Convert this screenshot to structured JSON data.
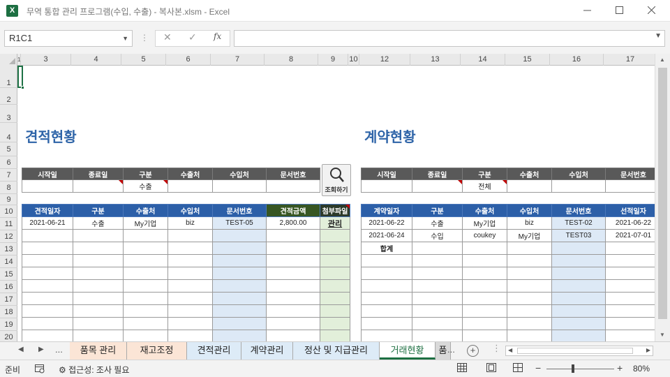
{
  "window": {
    "title": "무역 통합 관리 프로그램(수입, 수출) - 복사본.xlsm - Excel",
    "app_icon": "excel-icon",
    "accent": "#1d6f42"
  },
  "formula_bar": {
    "name_box": "R1C1",
    "fx": "fx",
    "formula": ""
  },
  "columns": [
    "1",
    "3",
    "4",
    "5",
    "6",
    "7",
    "8",
    "9",
    "10",
    "12",
    "13",
    "14",
    "15",
    "16",
    "17"
  ],
  "rows": [
    "1",
    "2",
    "3",
    "4",
    "5",
    "6",
    "7",
    "8",
    "9",
    "10",
    "11",
    "12",
    "13",
    "14",
    "15",
    "16",
    "17",
    "18",
    "19",
    "20"
  ],
  "quote": {
    "title": "견적현황",
    "filter_headers": [
      "시작일",
      "종료일",
      "구분",
      "수출처",
      "수입처",
      "문서번호"
    ],
    "filter_values": [
      "",
      "",
      "수출",
      "",
      "",
      ""
    ],
    "headers": [
      "견적일자",
      "구분",
      "수출처",
      "수입처",
      "문서번호",
      "견적금액",
      "첨부파일"
    ],
    "rows": [
      [
        "2021-06-21",
        "수출",
        "My기업",
        "biz",
        "TEST-05",
        "2,800.00",
        "관리"
      ]
    ]
  },
  "search_button": {
    "label": "조회하기",
    "icon": "magnifier-icon"
  },
  "contract": {
    "title": "계약현황",
    "filter_headers": [
      "시작일",
      "종료일",
      "구분",
      "수출처",
      "수입처",
      "문서번호"
    ],
    "filter_values": [
      "",
      "",
      "전체",
      "",
      "",
      ""
    ],
    "headers": [
      "계약일자",
      "구분",
      "수출처",
      "수입처",
      "문서번호",
      "선적일자"
    ],
    "rows": [
      [
        "2021-06-22",
        "수출",
        "My기업",
        "biz",
        "TEST-02",
        "2021-06-22"
      ],
      [
        "2021-06-24",
        "수입",
        "coukey",
        "My기업",
        "TEST03",
        "2021-07-01"
      ]
    ],
    "total_label": "합계"
  },
  "sheet_tabs": {
    "items": [
      "품목 관리",
      "재고조정",
      "견적관리",
      "계약관리",
      "정산 및 지급관리",
      "거래현황",
      "품"
    ],
    "active": "거래현황",
    "more": "..."
  },
  "status": {
    "ready": "준비",
    "accessibility": "접근성: 조사 필요",
    "zoom": "80%"
  }
}
